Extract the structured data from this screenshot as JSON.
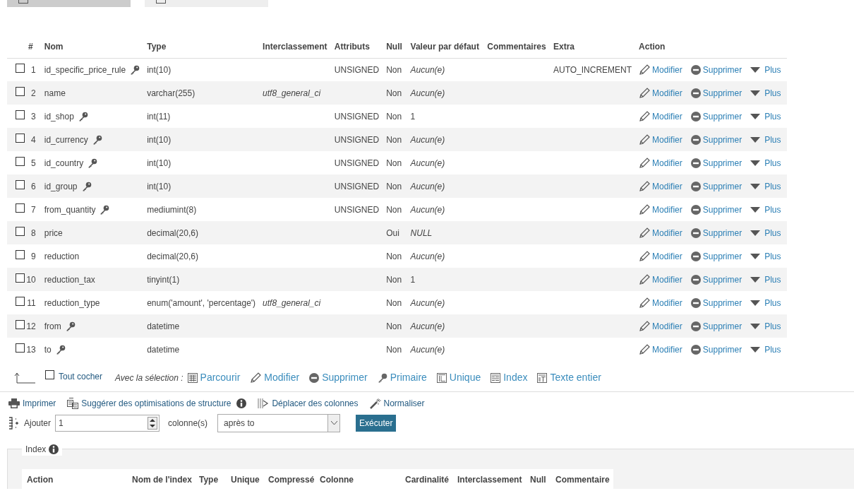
{
  "tabs": [
    {
      "selected": true
    },
    {
      "selected": false
    }
  ],
  "columns": [
    "#",
    "Nom",
    "Type",
    "Interclassement",
    "Attributs",
    "Null",
    "Valeur par défaut",
    "Commentaires",
    "Extra",
    "Action"
  ],
  "rows": [
    {
      "checked": false,
      "number": "1",
      "name": "id_specific_price_rule",
      "key": true,
      "type": "int(10)",
      "collation": "",
      "attributes": "UNSIGNED",
      "null": "Non",
      "default": "Aucun(e)",
      "default_italic": true,
      "extra": "AUTO_INCREMENT",
      "actions": [
        {
          "kind": "edit",
          "label": "Modifier"
        },
        {
          "kind": "delete",
          "label": "Supprimer"
        },
        {
          "kind": "more",
          "label": "Plus"
        }
      ]
    },
    {
      "checked": false,
      "number": "2",
      "name": "name",
      "key": false,
      "type": "varchar(255)",
      "collation": "utf8_general_ci",
      "attributes": "",
      "null": "Non",
      "default": "Aucun(e)",
      "default_italic": true,
      "extra": "",
      "actions": [
        {
          "kind": "edit",
          "label": "Modifier"
        },
        {
          "kind": "delete",
          "label": "Supprimer"
        },
        {
          "kind": "more",
          "label": "Plus"
        }
      ]
    },
    {
      "checked": false,
      "number": "3",
      "name": "id_shop",
      "key": true,
      "type": "int(11)",
      "collation": "",
      "attributes": "UNSIGNED",
      "null": "Non",
      "default": "1",
      "default_italic": false,
      "extra": "",
      "actions": [
        {
          "kind": "edit",
          "label": "Modifier"
        },
        {
          "kind": "delete",
          "label": "Supprimer"
        },
        {
          "kind": "more",
          "label": "Plus"
        }
      ]
    },
    {
      "checked": false,
      "number": "4",
      "name": "id_currency",
      "key": true,
      "type": "int(10)",
      "collation": "",
      "attributes": "UNSIGNED",
      "null": "Non",
      "default": "Aucun(e)",
      "default_italic": true,
      "extra": "",
      "actions": [
        {
          "kind": "edit",
          "label": "Modifier"
        },
        {
          "kind": "delete",
          "label": "Supprimer"
        },
        {
          "kind": "more",
          "label": "Plus"
        }
      ]
    },
    {
      "checked": false,
      "number": "5",
      "name": "id_country",
      "key": true,
      "type": "int(10)",
      "collation": "",
      "attributes": "UNSIGNED",
      "null": "Non",
      "default": "Aucun(e)",
      "default_italic": true,
      "extra": "",
      "actions": [
        {
          "kind": "edit",
          "label": "Modifier"
        },
        {
          "kind": "delete",
          "label": "Supprimer"
        },
        {
          "kind": "more",
          "label": "Plus"
        }
      ]
    },
    {
      "checked": false,
      "number": "6",
      "name": "id_group",
      "key": true,
      "type": "int(10)",
      "collation": "",
      "attributes": "UNSIGNED",
      "null": "Non",
      "default": "Aucun(e)",
      "default_italic": true,
      "extra": "",
      "actions": [
        {
          "kind": "edit",
          "label": "Modifier"
        },
        {
          "kind": "delete",
          "label": "Supprimer"
        },
        {
          "kind": "more",
          "label": "Plus"
        }
      ]
    },
    {
      "checked": false,
      "number": "7",
      "name": "from_quantity",
      "key": true,
      "type": "mediumint(8)",
      "collation": "",
      "attributes": "UNSIGNED",
      "null": "Non",
      "default": "Aucun(e)",
      "default_italic": true,
      "extra": "",
      "actions": [
        {
          "kind": "edit",
          "label": "Modifier"
        },
        {
          "kind": "delete",
          "label": "Supprimer"
        },
        {
          "kind": "more",
          "label": "Plus"
        }
      ]
    },
    {
      "checked": false,
      "number": "8",
      "name": "price",
      "key": false,
      "type": "decimal(20,6)",
      "collation": "",
      "attributes": "",
      "null": "Oui",
      "default": "NULL",
      "default_italic": true,
      "extra": "",
      "actions": [
        {
          "kind": "edit",
          "label": "Modifier"
        },
        {
          "kind": "delete",
          "label": "Supprimer"
        },
        {
          "kind": "more",
          "label": "Plus"
        }
      ]
    },
    {
      "checked": false,
      "number": "9",
      "name": "reduction",
      "key": false,
      "type": "decimal(20,6)",
      "collation": "",
      "attributes": "",
      "null": "Non",
      "default": "Aucun(e)",
      "default_italic": true,
      "extra": "",
      "actions": [
        {
          "kind": "edit",
          "label": "Modifier"
        },
        {
          "kind": "delete",
          "label": "Supprimer"
        },
        {
          "kind": "more",
          "label": "Plus"
        }
      ]
    },
    {
      "checked": false,
      "number": "10",
      "name": "reduction_tax",
      "key": false,
      "type": "tinyint(1)",
      "collation": "",
      "attributes": "",
      "null": "Non",
      "default": "1",
      "default_italic": false,
      "extra": "",
      "actions": [
        {
          "kind": "edit",
          "label": "Modifier"
        },
        {
          "kind": "delete",
          "label": "Supprimer"
        },
        {
          "kind": "more",
          "label": "Plus"
        }
      ]
    },
    {
      "checked": false,
      "number": "11",
      "name": "reduction_type",
      "key": false,
      "type": "enum('amount', 'percentage')",
      "collation": "utf8_general_ci",
      "attributes": "",
      "null": "Non",
      "default": "Aucun(e)",
      "default_italic": true,
      "extra": "",
      "actions": [
        {
          "kind": "edit",
          "label": "Modifier"
        },
        {
          "kind": "delete",
          "label": "Supprimer"
        },
        {
          "kind": "more",
          "label": "Plus"
        }
      ]
    },
    {
      "checked": false,
      "number": "12",
      "name": "from",
      "key": true,
      "type": "datetime",
      "collation": "",
      "attributes": "",
      "null": "Non",
      "default": "Aucun(e)",
      "default_italic": true,
      "extra": "",
      "actions": [
        {
          "kind": "edit",
          "label": "Modifier"
        },
        {
          "kind": "delete",
          "label": "Supprimer"
        },
        {
          "kind": "more",
          "label": "Plus"
        }
      ]
    },
    {
      "checked": false,
      "number": "13",
      "name": "to",
      "key": true,
      "type": "datetime",
      "collation": "",
      "attributes": "",
      "null": "Non",
      "default": "Aucun(e)",
      "default_italic": true,
      "extra": "",
      "actions": [
        {
          "kind": "edit",
          "label": "Modifier"
        },
        {
          "kind": "delete",
          "label": "Supprimer"
        },
        {
          "kind": "more",
          "label": "Plus"
        }
      ]
    }
  ],
  "selection_bar": {
    "check_all": {
      "label": "Tout cocher",
      "checked": false
    },
    "with_selection": "Avec la sélection :",
    "actions": [
      {
        "kind": "browse",
        "label": "Parcourir"
      },
      {
        "kind": "edit",
        "label": "Modifier"
      },
      {
        "kind": "delete",
        "label": "Supprimer"
      },
      {
        "kind": "primary",
        "label": "Primaire"
      },
      {
        "kind": "unique",
        "label": "Unique"
      },
      {
        "kind": "index",
        "label": "Index"
      },
      {
        "kind": "fulltext",
        "label": "Texte entier"
      }
    ]
  },
  "tools": [
    {
      "kind": "print",
      "label": "Imprimer"
    },
    {
      "kind": "optimize",
      "label": "Suggérer des optimisations de structure"
    },
    {
      "kind": "move",
      "label": "Déplacer des colonnes"
    },
    {
      "kind": "normalize",
      "label": "Normaliser"
    }
  ],
  "add_columns": {
    "label": "Ajouter",
    "value": "1",
    "unit": "colonne(s)",
    "position": "après to",
    "button": "Exécuter"
  },
  "index": {
    "legend": "Index",
    "columns": [
      "Action",
      "Nom de l'index",
      "Type",
      "Unique",
      "Compressé",
      "Colonne",
      "Cardinalité",
      "Interclassement",
      "Null",
      "Commentaire"
    ]
  }
}
